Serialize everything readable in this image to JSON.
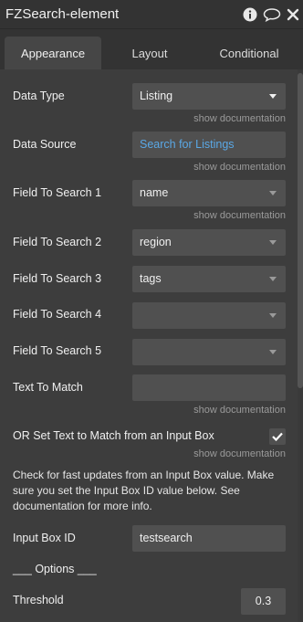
{
  "window": {
    "title": "FZSearch-element"
  },
  "tabs": [
    {
      "label": "Appearance"
    },
    {
      "label": "Layout"
    },
    {
      "label": "Conditional"
    }
  ],
  "doc_link": "show documentation",
  "fields": {
    "data_type": {
      "label": "Data Type",
      "value": "Listing"
    },
    "data_source": {
      "label": "Data Source",
      "value": "Search for Listings"
    },
    "field1": {
      "label": "Field To Search 1",
      "value": "name"
    },
    "field2": {
      "label": "Field To Search 2",
      "value": "region"
    },
    "field3": {
      "label": "Field To Search 3",
      "value": "tags"
    },
    "field4": {
      "label": "Field To Search 4",
      "value": ""
    },
    "field5": {
      "label": "Field To Search 5",
      "value": ""
    },
    "text_to_match": {
      "label": "Text To Match",
      "value": ""
    },
    "input_box_toggle": {
      "label": "OR Set Text to Match from an Input Box",
      "checked": true
    },
    "help_text": "Check for fast updates from an Input Box value. Make sure you set the Input Box ID value below. See documentation for more info.",
    "input_box_id": {
      "label": "Input Box ID",
      "value": "testsearch"
    },
    "options_header": "___ Options ___",
    "threshold": {
      "label": "Threshold",
      "value": "0.3"
    }
  },
  "colors": {
    "background": "#3d3d3d",
    "field": "#505050",
    "link": "#5aa8e6",
    "muted": "#9a9a9a"
  }
}
